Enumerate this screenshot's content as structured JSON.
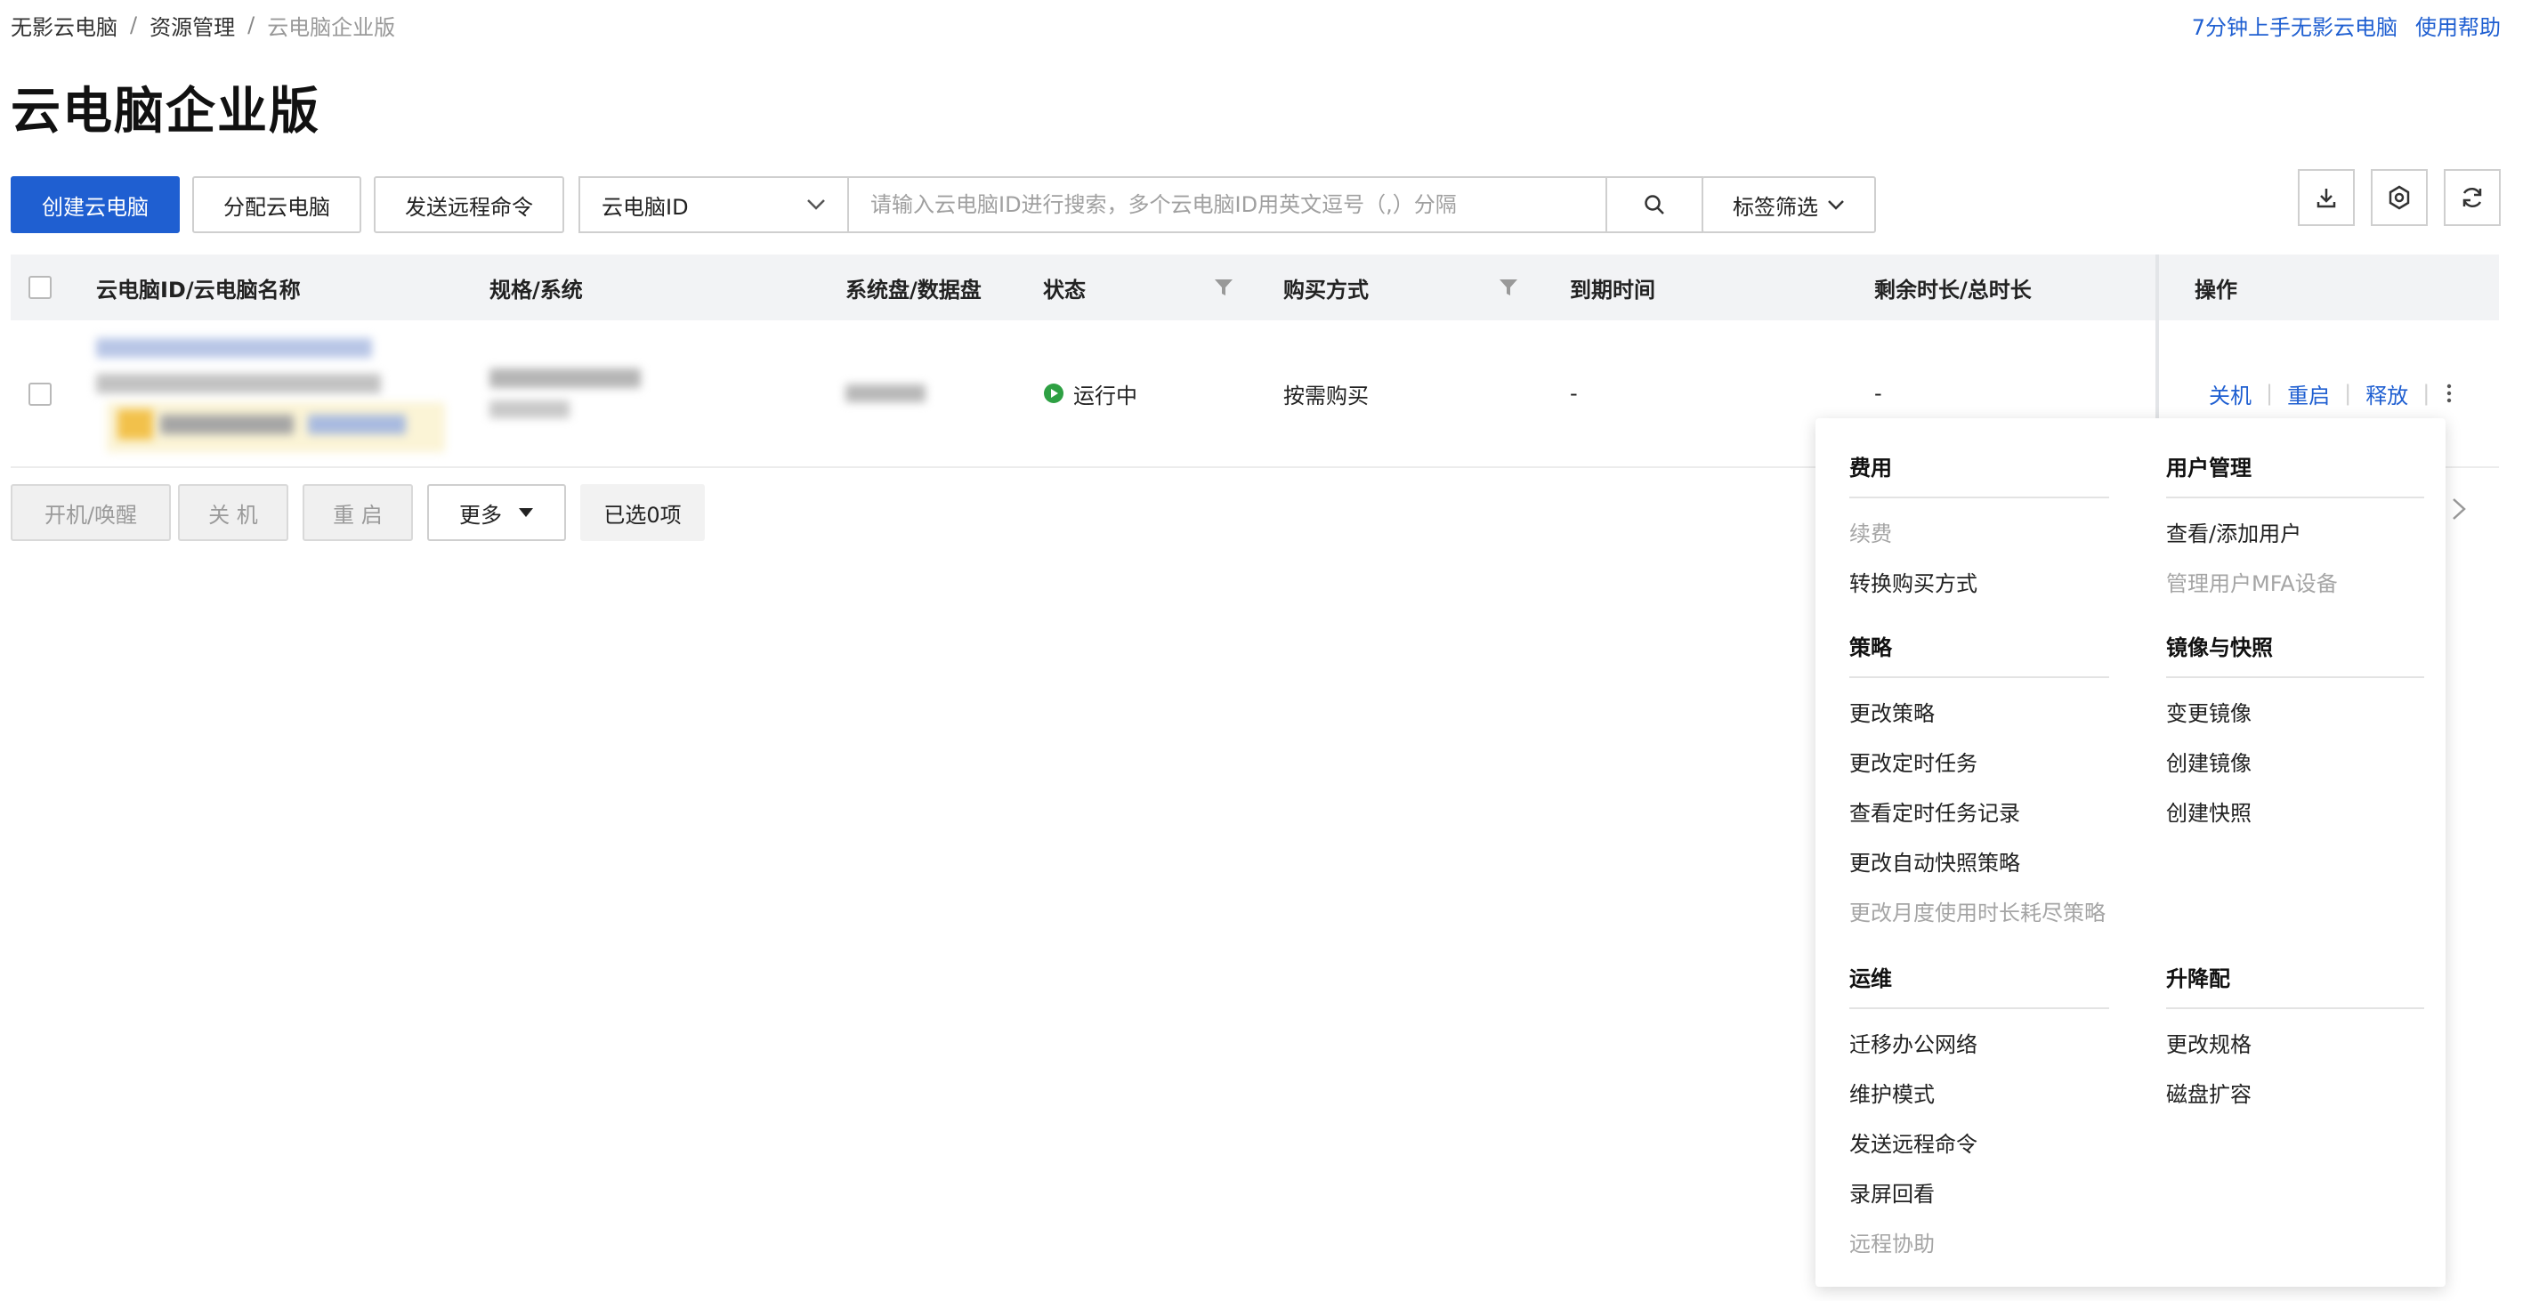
{
  "breadcrumb": [
    "无影云电脑",
    "资源管理",
    "云电脑企业版"
  ],
  "help_links": [
    "7分钟上手无影云电脑",
    "使用帮助"
  ],
  "page_title": "云电脑企业版",
  "toolbar": {
    "create_label": "创建云电脑",
    "assign_label": "分配云电脑",
    "remote_cmd_label": "发送远程命令",
    "select_value": "云电脑ID",
    "search_placeholder": "请输入云电脑ID进行搜索，多个云电脑ID用英文逗号（,）分隔",
    "tag_filter_label": "标签筛选"
  },
  "icons": [
    "download-icon",
    "settings-icon",
    "refresh-icon",
    "search-icon",
    "filter-icon",
    "chevron-down-icon",
    "more-icon",
    "chevron-right-icon"
  ],
  "table": {
    "columns": [
      "云电脑ID/云电脑名称",
      "规格/系统",
      "系统盘/数据盘",
      "状态",
      "购买方式",
      "到期时间",
      "剩余时长/总时长",
      "操作"
    ],
    "row": {
      "status": "运行中",
      "purchase": "按需购买",
      "expire": "-",
      "remaining": "-",
      "actions": [
        "关机",
        "重启",
        "释放"
      ]
    },
    "colors": {
      "status_running": "#2ea043",
      "link": "#1f5fd1"
    }
  },
  "bulk": {
    "start_label": "开机/唤醒",
    "stop_label": "关 机",
    "restart_label": "重 启",
    "more_label": "更多",
    "selected_label": "已选0项"
  },
  "menu": {
    "fee": {
      "title": "费用",
      "items": [
        {
          "label": "续费",
          "disabled": true
        },
        {
          "label": "转换购买方式",
          "disabled": false
        }
      ]
    },
    "user": {
      "title": "用户管理",
      "items": [
        {
          "label": "查看/添加用户",
          "disabled": false
        },
        {
          "label": "管理用户MFA设备",
          "disabled": true
        }
      ]
    },
    "policy": {
      "title": "策略",
      "items": [
        {
          "label": "更改策略",
          "disabled": false
        },
        {
          "label": "更改定时任务",
          "disabled": false
        },
        {
          "label": "查看定时任务记录",
          "disabled": false
        },
        {
          "label": "更改自动快照策略",
          "disabled": false
        },
        {
          "label": "更改月度使用时长耗尽策略",
          "disabled": true
        }
      ]
    },
    "image": {
      "title": "镜像与快照",
      "items": [
        {
          "label": "变更镜像",
          "disabled": false
        },
        {
          "label": "创建镜像",
          "disabled": false
        },
        {
          "label": "创建快照",
          "disabled": false
        }
      ]
    },
    "ops": {
      "title": "运维",
      "items": [
        {
          "label": "迁移办公网络",
          "disabled": false
        },
        {
          "label": "维护模式",
          "disabled": false
        },
        {
          "label": "发送远程命令",
          "disabled": false
        },
        {
          "label": "录屏回看",
          "disabled": false
        },
        {
          "label": "远程协助",
          "disabled": true
        }
      ]
    },
    "upgrade": {
      "title": "升降配",
      "items": [
        {
          "label": "更改规格",
          "disabled": false
        },
        {
          "label": "磁盘扩容",
          "disabled": false
        }
      ]
    }
  }
}
